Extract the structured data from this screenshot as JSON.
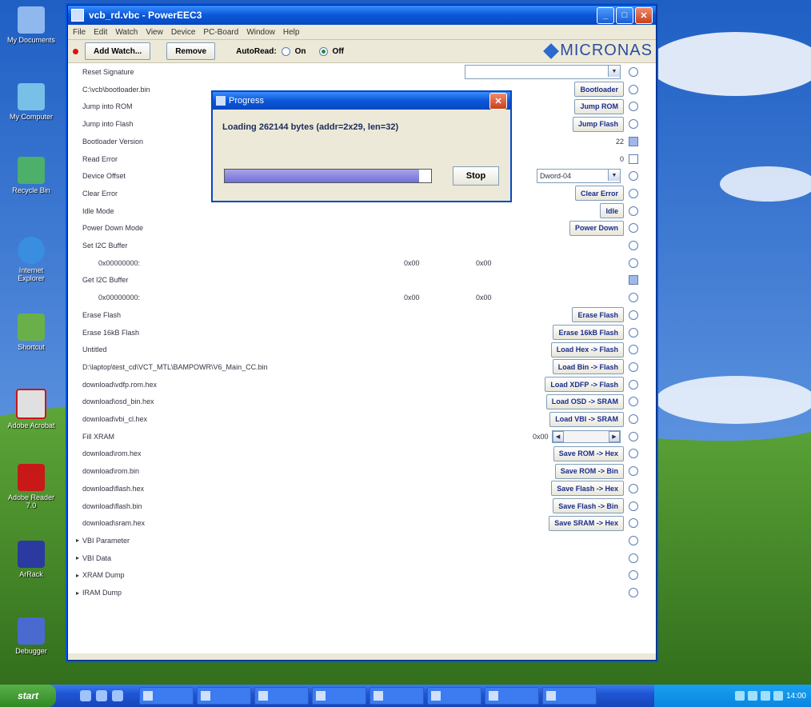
{
  "window": {
    "title": "vcb_rd.vbc - PowerEEC3",
    "menu": [
      "File",
      "Edit",
      "Watch",
      "View",
      "Device",
      "PC-Board",
      "Window",
      "Help"
    ]
  },
  "toolbar": {
    "add_watch": "Add Watch...",
    "remove": "Remove",
    "autoread_label": "AutoRead:",
    "on_label": "On",
    "off_label": "Off",
    "logo_text": "MICRONAS"
  },
  "rows": [
    {
      "label": "Reset Signature",
      "control": "combo",
      "combo_value": ""
    },
    {
      "label": "C:\\vcb\\bootloader.bin",
      "action": "Bootloader"
    },
    {
      "label": "Jump into ROM",
      "action": "Jump ROM"
    },
    {
      "label": "Jump into Flash",
      "action": "Jump Flash"
    },
    {
      "label": "Bootloader Version",
      "value": "22",
      "control": "checkbox"
    },
    {
      "label": "Read Error",
      "value": "0",
      "control": "checkbox"
    },
    {
      "label": "Device Offset",
      "control": "combo",
      "combo_value": "Dword-04"
    },
    {
      "label": "Clear Error",
      "action": "Clear Error"
    },
    {
      "label": "Idle Mode",
      "action": "Idle"
    },
    {
      "label": "Power Down Mode",
      "action": "Power Down"
    },
    {
      "label": "Set I2C Buffer"
    },
    {
      "label": "0x00000000:",
      "indent": true,
      "v1": "0x00",
      "v2": "0x00"
    },
    {
      "label": "Get I2C Buffer",
      "control": "checkbox"
    },
    {
      "label": "0x00000000:",
      "indent": true,
      "v1": "0x00",
      "v2": "0x00"
    },
    {
      "label": "Erase Flash",
      "action": "Erase Flash"
    },
    {
      "label": "Erase 16kB Flash",
      "action": "Erase 16kB Flash"
    },
    {
      "label": "Untitled",
      "action": "Load Hex -> Flash"
    },
    {
      "label": "D:\\laptop\\test_cd\\VCT_MTL\\BAMPOWR\\V6_Main_CC.bin",
      "action": "Load Bin -> Flash"
    },
    {
      "label": "download\\vdfp.rom.hex",
      "action": "Load XDFP -> Flash"
    },
    {
      "label": "download\\osd_bin.hex",
      "action": "Load OSD -> SRAM"
    },
    {
      "label": "download\\vbi_cl.hex",
      "action": "Load VBI -> SRAM"
    },
    {
      "label": "Fill XRAM",
      "control": "scroll",
      "scroll_value": "0x00"
    },
    {
      "label": "download\\rom.hex",
      "action": "Save ROM -> Hex"
    },
    {
      "label": "download\\rom.bin",
      "action": "Save ROM -> Bin"
    },
    {
      "label": "download\\flash.hex",
      "action": "Save Flash -> Hex"
    },
    {
      "label": "download\\flash.bin",
      "action": "Save Flash -> Bin"
    },
    {
      "label": "download\\sram.hex",
      "action": "Save SRAM -> Hex"
    }
  ],
  "tree": [
    "VBI Parameter",
    "VBI Data",
    "XRAM Dump",
    "IRAM Dump"
  ],
  "dialog": {
    "title": "Progress",
    "message": "Loading 262144 bytes (addr=2x29, len=32)",
    "progress": 0.94,
    "stop": "Stop"
  },
  "desktop_icons": [
    "My Documents",
    "My Computer",
    "Recycle Bin",
    "Internet Explorer",
    "Shortcut",
    "Adobe Acrobat",
    "Adobe Reader 7.0",
    "ArRack",
    "Debugger"
  ],
  "taskbar": {
    "start": "start",
    "clock": "14:00",
    "tasks": [
      "",
      "",
      "",
      "",
      "",
      "",
      "",
      ""
    ]
  }
}
